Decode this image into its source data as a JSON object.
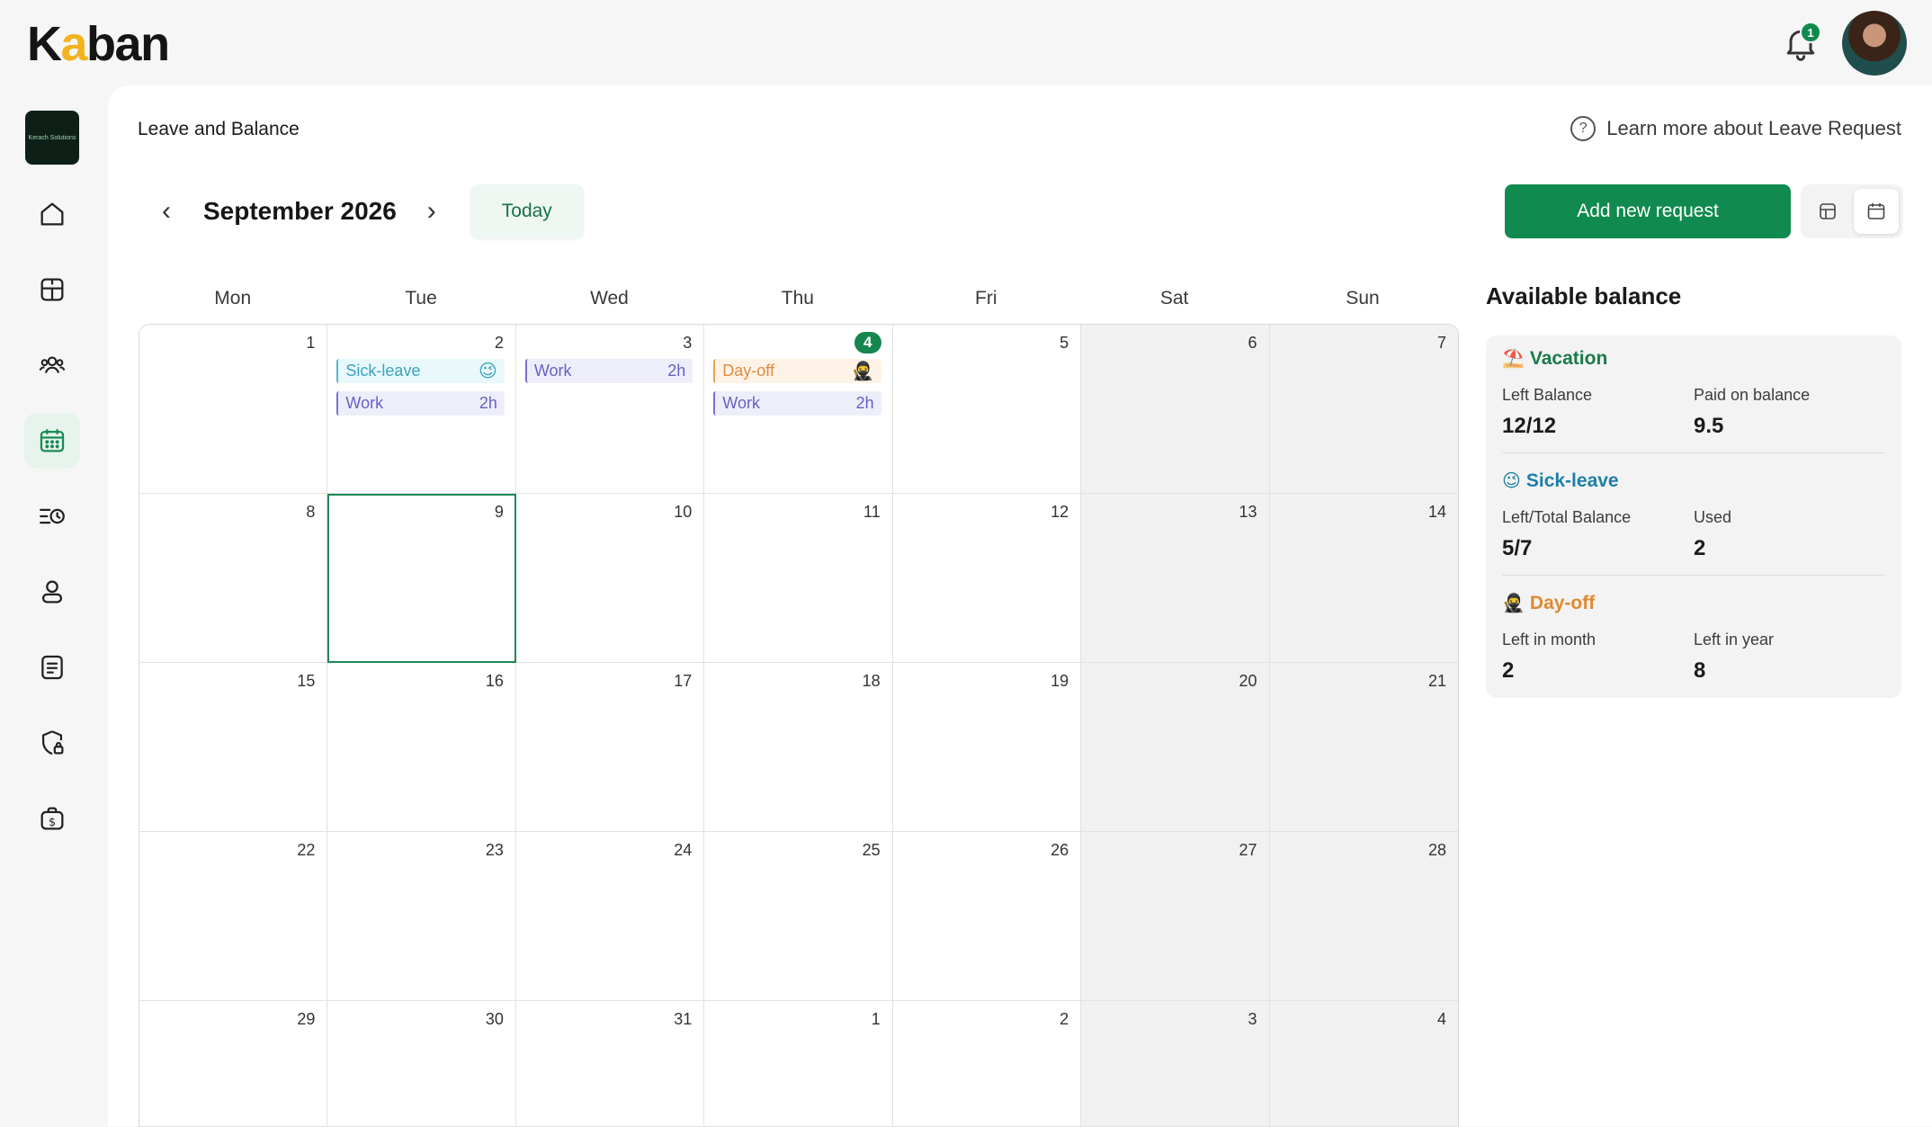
{
  "app": {
    "logo_pre": "K",
    "logo_accent": "a",
    "logo_post": "ban",
    "org_logo_text": "Kerach Solutions",
    "notification_count": "1"
  },
  "header": {
    "title": "Leave and Balance",
    "help_text": "Learn more about Leave Request",
    "help_icon": "?"
  },
  "toolbar": {
    "month_label": "September 2026",
    "prev": "‹",
    "next": "›",
    "today_label": "Today",
    "add_label": "Add new request"
  },
  "calendar": {
    "days": [
      "Mon",
      "Tue",
      "Wed",
      "Thu",
      "Fri",
      "Sat",
      "Sun"
    ],
    "weeks": [
      [
        "1",
        "2",
        "3",
        "4",
        "5",
        "6",
        "7"
      ],
      [
        "8",
        "9",
        "10",
        "11",
        "12",
        "13",
        "14"
      ],
      [
        "15",
        "16",
        "17",
        "18",
        "19",
        "20",
        "21"
      ],
      [
        "22",
        "23",
        "24",
        "25",
        "26",
        "27",
        "28"
      ],
      [
        "29",
        "30",
        "31",
        "1",
        "2",
        "3",
        "4"
      ]
    ],
    "events": {
      "tue2_sick": "Sick-leave",
      "tue2_sick_emoji": "😉",
      "tue2_work": "Work",
      "tue2_work_hours": "2h",
      "wed3_work": "Work",
      "wed3_work_hours": "2h",
      "thu4_dayoff": "Day-off",
      "thu4_dayoff_emoji": "🥷",
      "thu4_work": "Work",
      "thu4_work_hours": "2h"
    }
  },
  "balance": {
    "title": "Available balance",
    "vacation": {
      "emoji": "⛱️",
      "name": "Vacation",
      "label1": "Left Balance",
      "value1": "12/12",
      "label2": "Paid on balance",
      "value2": "9.5"
    },
    "sick": {
      "emoji": "😉",
      "name": "Sick-leave",
      "label1": "Left/Total Balance",
      "value1": "5/7",
      "label2": "Used",
      "value2": "2"
    },
    "dayoff": {
      "emoji": "🥷",
      "name": "Day-off",
      "label1": "Left in month",
      "value1": "2",
      "label2": "Left in year",
      "value2": "8"
    }
  },
  "colors": {
    "brand_green": "#118a4f",
    "logo_accent": "#f2b31d",
    "sick": "#3aa3bd",
    "work": "#6a5fc4",
    "dayoff": "#df8b3e"
  }
}
